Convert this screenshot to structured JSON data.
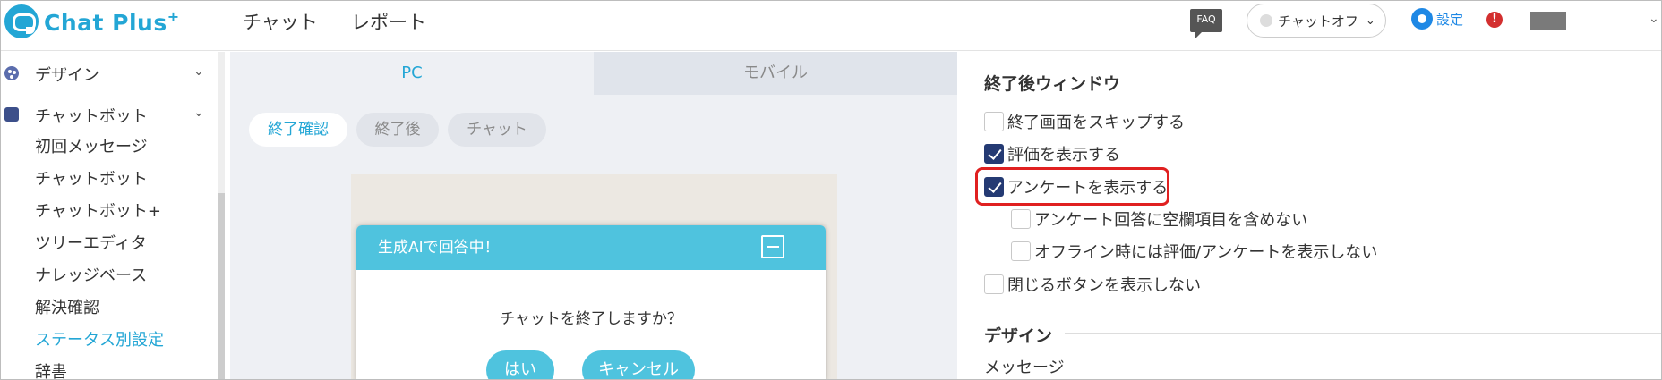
{
  "header": {
    "logo_text": "Chat Plus",
    "logo_sup": "+",
    "nav": [
      "チャット",
      "レポート"
    ],
    "faq_label": "FAQ",
    "status_label": "チャットオフ",
    "settings_label": "設定",
    "alert_label": "!",
    "colors": {
      "brand": "#23a6d5",
      "settings": "#1e88e5",
      "alert": "#d32f2f"
    }
  },
  "sidebar": {
    "sections": [
      {
        "label": "デザイン",
        "icon": "palette-icon"
      },
      {
        "label": "チャットボット",
        "icon": "chat-bubble-icon"
      }
    ],
    "items": [
      "初回メッセージ",
      "チャットボット",
      "チャットボット+",
      "ツリーエディタ",
      "ナレッジベース",
      "解決確認",
      "ステータス別設定",
      "辞書"
    ],
    "active_index": 6
  },
  "preview": {
    "tabs": [
      "PC",
      "モバイル"
    ],
    "selected_tab": "PC",
    "subtabs": [
      "終了確認",
      "終了後",
      "チャット"
    ],
    "selected_subtab": "終了確認",
    "dialog": {
      "title": "生成AIで回答中！",
      "question": "チャットを終了しますか？",
      "yes": "はい",
      "cancel": "キャンセル",
      "color": "#4fc3de"
    }
  },
  "panel": {
    "section_title": "終了後ウィンドウ",
    "options": [
      {
        "label": "終了画面をスキップする",
        "checked": false
      },
      {
        "label": "評価を表示する",
        "checked": true
      },
      {
        "label": "アンケートを表示する",
        "checked": true
      },
      {
        "label": "アンケート回答に空欄項目を含めない",
        "checked": false
      },
      {
        "label": "オフライン時には評価/アンケートを表示しない",
        "checked": false
      },
      {
        "label": "閉じるボタンを表示しない",
        "checked": false
      }
    ],
    "design_title": "デザイン",
    "message_label": "メッセージ",
    "checkbox_color": "#243a73",
    "highlight_color": "#e02020"
  }
}
